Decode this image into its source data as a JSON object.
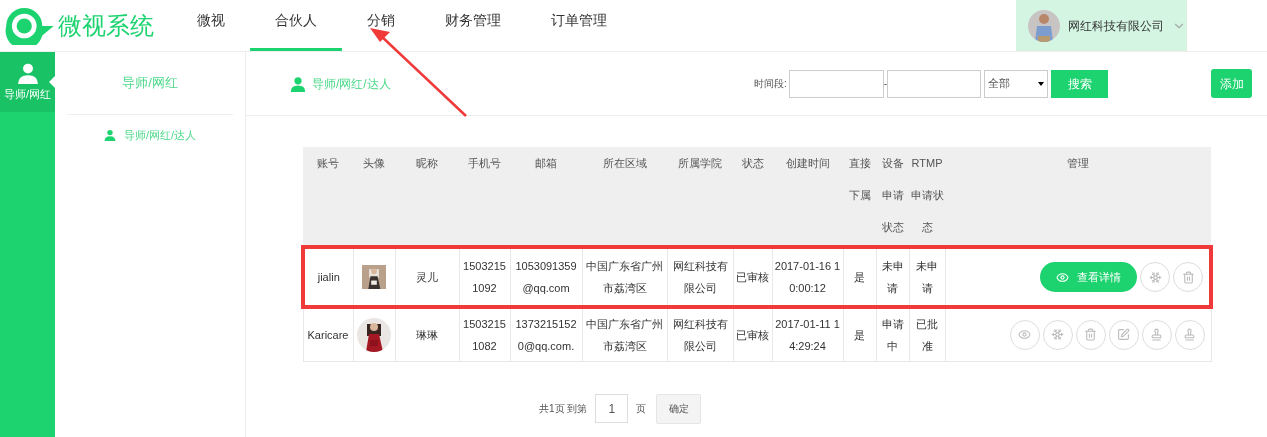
{
  "logo": {
    "text": "微视系统"
  },
  "nav": [
    {
      "label": "微视",
      "selected": false,
      "pointed": false
    },
    {
      "label": "合伙人",
      "selected": true,
      "pointed": false
    },
    {
      "label": "分销",
      "selected": false,
      "pointed": true
    },
    {
      "label": "财务管理",
      "selected": false,
      "pointed": false
    },
    {
      "label": "订单管理",
      "selected": false,
      "pointed": false
    }
  ],
  "user": {
    "name": "网红科技有限公司"
  },
  "rail": [
    {
      "label": "导师/网红",
      "selected": true
    }
  ],
  "subnav": {
    "title": "导师/网红",
    "items": [
      {
        "label": "导师/网红/达人"
      }
    ]
  },
  "breadcrumb": "导师/网红/达人",
  "filter": {
    "label": "时间段:",
    "separator": "-",
    "select_value": "全部",
    "search_button": "搜索"
  },
  "add_button": "添加",
  "table": {
    "columns": [
      "账号",
      "头像",
      "昵称",
      "手机号",
      "邮箱",
      "所在区域",
      "所属学院",
      "状态",
      "创建时间",
      "直接下属",
      "设备申请状态",
      "RTMP申请状态",
      "管理"
    ],
    "rows": [
      {
        "highlighted": true,
        "account": "jialin",
        "nickname": "灵儿",
        "phone": "15032151092",
        "email": "1053091359@qq.com",
        "region": "中国广东省广州市荔湾区",
        "college": "网红科技有限公司",
        "status": "已审核",
        "created": "2017-01-16 10:00:12",
        "direct": "是",
        "device": "未申请",
        "rtmp": "未申请",
        "actions": [
          {
            "kind": "view",
            "label": "查看详情"
          },
          {
            "kind": "freeze"
          },
          {
            "kind": "delete"
          }
        ]
      },
      {
        "highlighted": false,
        "account": "Karicare",
        "nickname": "琳琳",
        "phone": "15032151082",
        "email": "13732151520@qq.com.",
        "region": "中国广东省广州市荔湾区",
        "college": "网红科技有限公司",
        "status": "已审核",
        "created": "2017-01-11 14:29:24",
        "direct": "是",
        "device": "申请中",
        "rtmp": "已批准",
        "actions": [
          {
            "kind": "view"
          },
          {
            "kind": "freeze"
          },
          {
            "kind": "delete"
          },
          {
            "kind": "edit"
          },
          {
            "kind": "stamp"
          },
          {
            "kind": "stamp"
          }
        ]
      }
    ]
  },
  "pagination": {
    "total": "共1页 到第",
    "page_value": "1",
    "unit": "页",
    "confirm": "确定"
  }
}
